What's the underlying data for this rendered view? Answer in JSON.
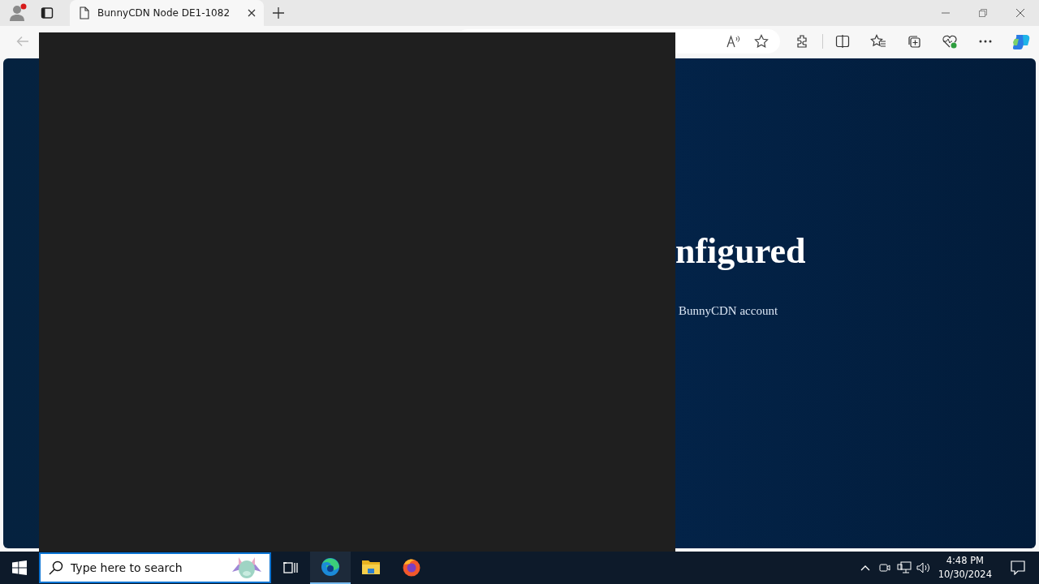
{
  "browser": {
    "tab": {
      "title": "BunnyCDN Node DE1-1082",
      "selected": true
    }
  },
  "page": {
    "heading": "nfigured",
    "text": "BunnyCDN account"
  },
  "taskbar": {
    "search": {
      "placeholder": "Type here to search"
    },
    "apps": [
      {
        "kind": "edge",
        "selected": true
      },
      {
        "kind": "explorer",
        "selected": false
      },
      {
        "kind": "firefox",
        "selected": false
      }
    ],
    "time": "4:48 PM",
    "date": "10/30/2024"
  }
}
